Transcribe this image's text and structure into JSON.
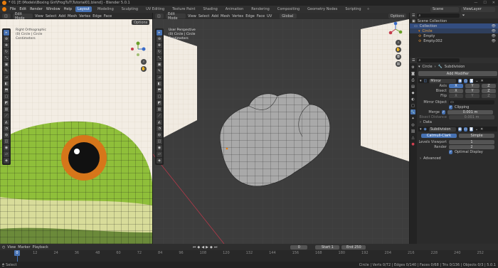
{
  "titlebar": {
    "title": "* 01 [E:\\Models\\Boxing Girl\\FrogTuT\\Tutorial01.blend] - Blender 5.0.1",
    "min": "—",
    "max": "☐",
    "close": "✕"
  },
  "menu": [
    "File",
    "Edit",
    "Render",
    "Window",
    "Help"
  ],
  "workspaces": [
    "Layout",
    "Modeling",
    "Sculpting",
    "UV Editing",
    "Texture Paint",
    "Shading",
    "Animation",
    "Rendering",
    "Compositing",
    "Geometry Nodes",
    "Scripting"
  ],
  "active_workspace": "Layout",
  "scene": "Scene",
  "view_layer": "ViewLayer",
  "left_view": {
    "mode": "Edit Mode",
    "menus": [
      "View",
      "Select",
      "Add",
      "Mesh",
      "Vertex",
      "Edge",
      "Face",
      "UV"
    ],
    "overlay": [
      "Right Orthographic",
      "(0) Circle | Circle",
      "Centimeters"
    ],
    "options": "Options"
  },
  "main_view": {
    "mode": "Edit Mode",
    "menus": [
      "View",
      "Select",
      "Add",
      "Mesh",
      "Vertex",
      "Edge",
      "Face",
      "UV"
    ],
    "transform": "Global",
    "overlay": [
      "User Perspective",
      "(0) Circle | Circle",
      "Centimeters"
    ],
    "options": "Options"
  },
  "gizmo": {
    "x": "X",
    "y": "Y",
    "z": "Z"
  },
  "outliner": {
    "root": "Scene Collection",
    "items": [
      {
        "name": "Collection",
        "level": 0
      },
      {
        "name": "Circle",
        "level": 1
      },
      {
        "name": "Empty",
        "level": 1
      },
      {
        "name": "Empty.002",
        "level": 1
      }
    ]
  },
  "properties": {
    "breadcrumb": [
      "Circle",
      "Subdivision"
    ],
    "add_modifier": "Add Modifier",
    "mirror": {
      "name": "Mirror",
      "axis_label": "Axis",
      "bisect_label": "Bisect",
      "flip_label": "Flip",
      "axes": [
        "X",
        "Y",
        "Z"
      ],
      "mirror_object_label": "Mirror Object",
      "clipping": "Clipping",
      "merge_label": "Merge",
      "merge_value": "0.001 m",
      "bisect_distance_label": "Bisect Distance",
      "bisect_distance_value": "0.001 m",
      "data": "Data"
    },
    "subdivision": {
      "name": "Subdivision",
      "methods": [
        "Catmull-Clark",
        "Simple"
      ],
      "levels_viewport_label": "Levels Viewport",
      "levels_viewport": "1",
      "render_label": "Render",
      "render": "2",
      "optimal_display": "Optimal Display",
      "advanced": "Advanced"
    }
  },
  "timeline": {
    "menus": [
      "Playback",
      "View",
      "Marker"
    ],
    "current_frame": "0",
    "start_label": "Start",
    "start": "1",
    "end_label": "End",
    "end": "250",
    "ticks": [
      "0",
      "12",
      "24",
      "36",
      "48",
      "60",
      "72",
      "84",
      "96",
      "108",
      "120",
      "132",
      "144",
      "156",
      "168",
      "180",
      "192",
      "204",
      "216",
      "228",
      "240",
      "252"
    ]
  },
  "status": {
    "left": "Select",
    "right": "Circle | Verts 0/72 | Edges 0/140 | Faces 0/68 | Tris 0/136 | Objects 0/3 | 5.0.1"
  },
  "colors": {
    "accent": "#4772b3",
    "orange": "#e87d0d",
    "frog_green": "#8fbf3a",
    "header": "#303030"
  }
}
